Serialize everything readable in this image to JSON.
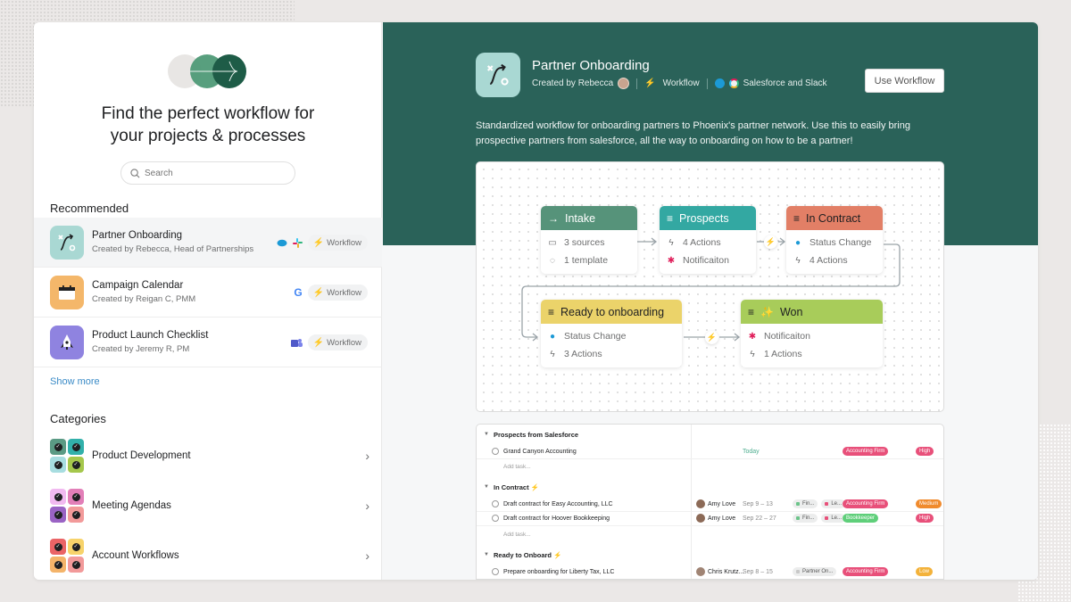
{
  "left": {
    "title_line1": "Find the perfect workflow for",
    "title_line2": "your projects & processes",
    "search": {
      "placeholder": "Search",
      "value": ""
    },
    "recommended_heading": "Recommended",
    "recommended": [
      {
        "name": "Partner Onboarding",
        "creator": "Created by Rebecca, Head of Partnerships",
        "integrations": [
          "salesforce-icon",
          "slack-icon"
        ],
        "badge": "Workflow",
        "icon": "flow-path-icon",
        "icon_bg": "#a9d8d3",
        "active": true
      },
      {
        "name": "Campaign Calendar",
        "creator": "Created by Reigan C, PMM",
        "integrations": [
          "google-icon"
        ],
        "badge": "Workflow",
        "icon": "calendar-icon",
        "icon_bg": "#f4b76a",
        "active": false
      },
      {
        "name": "Product Launch Checklist",
        "creator": "Created by Jeremy R, PM",
        "integrations": [
          "teams-icon"
        ],
        "badge": "Workflow",
        "icon": "rocket-icon",
        "icon_bg": "#8f83e0",
        "active": false
      }
    ],
    "show_more": "Show more",
    "categories_heading": "Categories",
    "categories": [
      {
        "name": "Product Development",
        "colors": [
          "#5a9a84",
          "#32b0aa",
          "#a7dde0",
          "#a5c74c"
        ]
      },
      {
        "name": "Meeting Agendas",
        "colors": [
          "#f1b9f0",
          "#e27fb8",
          "#9a63c4",
          "#f29a9a"
        ]
      },
      {
        "name": "Account Workflows",
        "colors": [
          "#ea6466",
          "#f7d36b",
          "#f4b46a",
          "#f29a9a"
        ]
      }
    ]
  },
  "detail": {
    "title": "Partner Onboarding",
    "created_by": "Created by Rebecca",
    "type": "Workflow",
    "integrations_label": "Salesforce and Slack",
    "use_button": "Use Workflow",
    "description": "Standardized workflow for onboarding partners to Phoenix's partner network. Use this to easily bring prospective partners from salesforce, all the way to onboarding on how to be a partner!",
    "header_color": "#2a6259"
  },
  "workflow": {
    "nodes": [
      {
        "id": "intake",
        "title": "Intake",
        "head_icon": "arrow-right-icon",
        "color": "#56937a",
        "text_color": "#ffffff",
        "rows": [
          {
            "icon": "inbox-icon",
            "label": "3 sources"
          },
          {
            "icon": "check-circle-icon",
            "label": "1 template"
          }
        ]
      },
      {
        "id": "prospects",
        "title": "Prospects",
        "head_icon": "list-icon",
        "color": "#33a8a2",
        "text_color": "#ffffff",
        "rows": [
          {
            "icon": "bolt-outline-icon",
            "label": "4 Actions"
          },
          {
            "icon": "slack-icon",
            "label": "Notificaiton"
          }
        ]
      },
      {
        "id": "in-contract",
        "title": "In Contract",
        "head_icon": "list-icon",
        "color": "#e27f66",
        "text_color": "#1e1f21",
        "rows": [
          {
            "icon": "salesforce-icon",
            "label": "Status Change"
          },
          {
            "icon": "bolt-outline-icon",
            "label": "4 Actions"
          }
        ]
      },
      {
        "id": "ready",
        "title": "Ready to onboarding",
        "head_icon": "list-icon",
        "color": "#ebd36a",
        "text_color": "#1e1f21",
        "rows": [
          {
            "icon": "salesforce-icon",
            "label": "Status Change"
          },
          {
            "icon": "bolt-outline-icon",
            "label": "3 Actions"
          }
        ]
      },
      {
        "id": "won",
        "title": "Won",
        "head_icon": "list-icon",
        "color": "#a8cc5a",
        "text_color": "#1e1f21",
        "rows": [
          {
            "icon": "slack-icon",
            "label": "Notificaiton"
          },
          {
            "icon": "bolt-outline-icon",
            "label": "1 Actions"
          }
        ]
      }
    ]
  },
  "task_table": {
    "sections": [
      {
        "name": "Prospects from Salesforce",
        "bolt": false,
        "tasks": [
          {
            "name": "Grand Canyon Accounting",
            "assignee": "",
            "date": "Today",
            "projects": [],
            "tag": {
              "label": "Accounting Firm",
              "color": "#e8507a"
            },
            "priority": {
              "label": "High",
              "color": "#e8507a"
            }
          }
        ],
        "add_task": "Add task..."
      },
      {
        "name": "In Contract",
        "bolt": true,
        "tasks": [
          {
            "name": "Draft contract for Easy Accounting, LLC",
            "assignee": "Amy Love",
            "date": "Sep 9 – 13",
            "projects": [
              {
                "label": "Fin...",
                "color": "#6cc48a"
              },
              {
                "label": "Le...",
                "color": "#e8507a"
              }
            ],
            "tag": {
              "label": "Accounting Firm",
              "color": "#e8507a"
            },
            "priority": {
              "label": "Medium",
              "color": "#f08a2c"
            }
          },
          {
            "name": "Draft contract for Hoover Bookkeeping",
            "assignee": "Amy Love",
            "date": "Sep 22 – 27",
            "projects": [
              {
                "label": "Fin...",
                "color": "#6cc48a"
              },
              {
                "label": "Le...",
                "color": "#e8507a"
              }
            ],
            "tag": {
              "label": "Bookkeeper",
              "color": "#5fcf7a"
            },
            "priority": {
              "label": "High",
              "color": "#e8507a"
            }
          }
        ],
        "add_task": "Add task..."
      },
      {
        "name": "Ready to Onboard",
        "bolt": true,
        "tasks": [
          {
            "name": "Prepare onboarding for Liberty Tax, LLC",
            "assignee": "Chris Krutz...",
            "date": "Sep 8 – 15",
            "projects": [
              {
                "label": "Partner On...",
                "color": "#c8c8c8"
              }
            ],
            "tag": {
              "label": "Accounting Firm",
              "color": "#e8507a"
            },
            "priority": {
              "label": "Low",
              "color": "#f3b23a"
            }
          }
        ]
      }
    ]
  }
}
